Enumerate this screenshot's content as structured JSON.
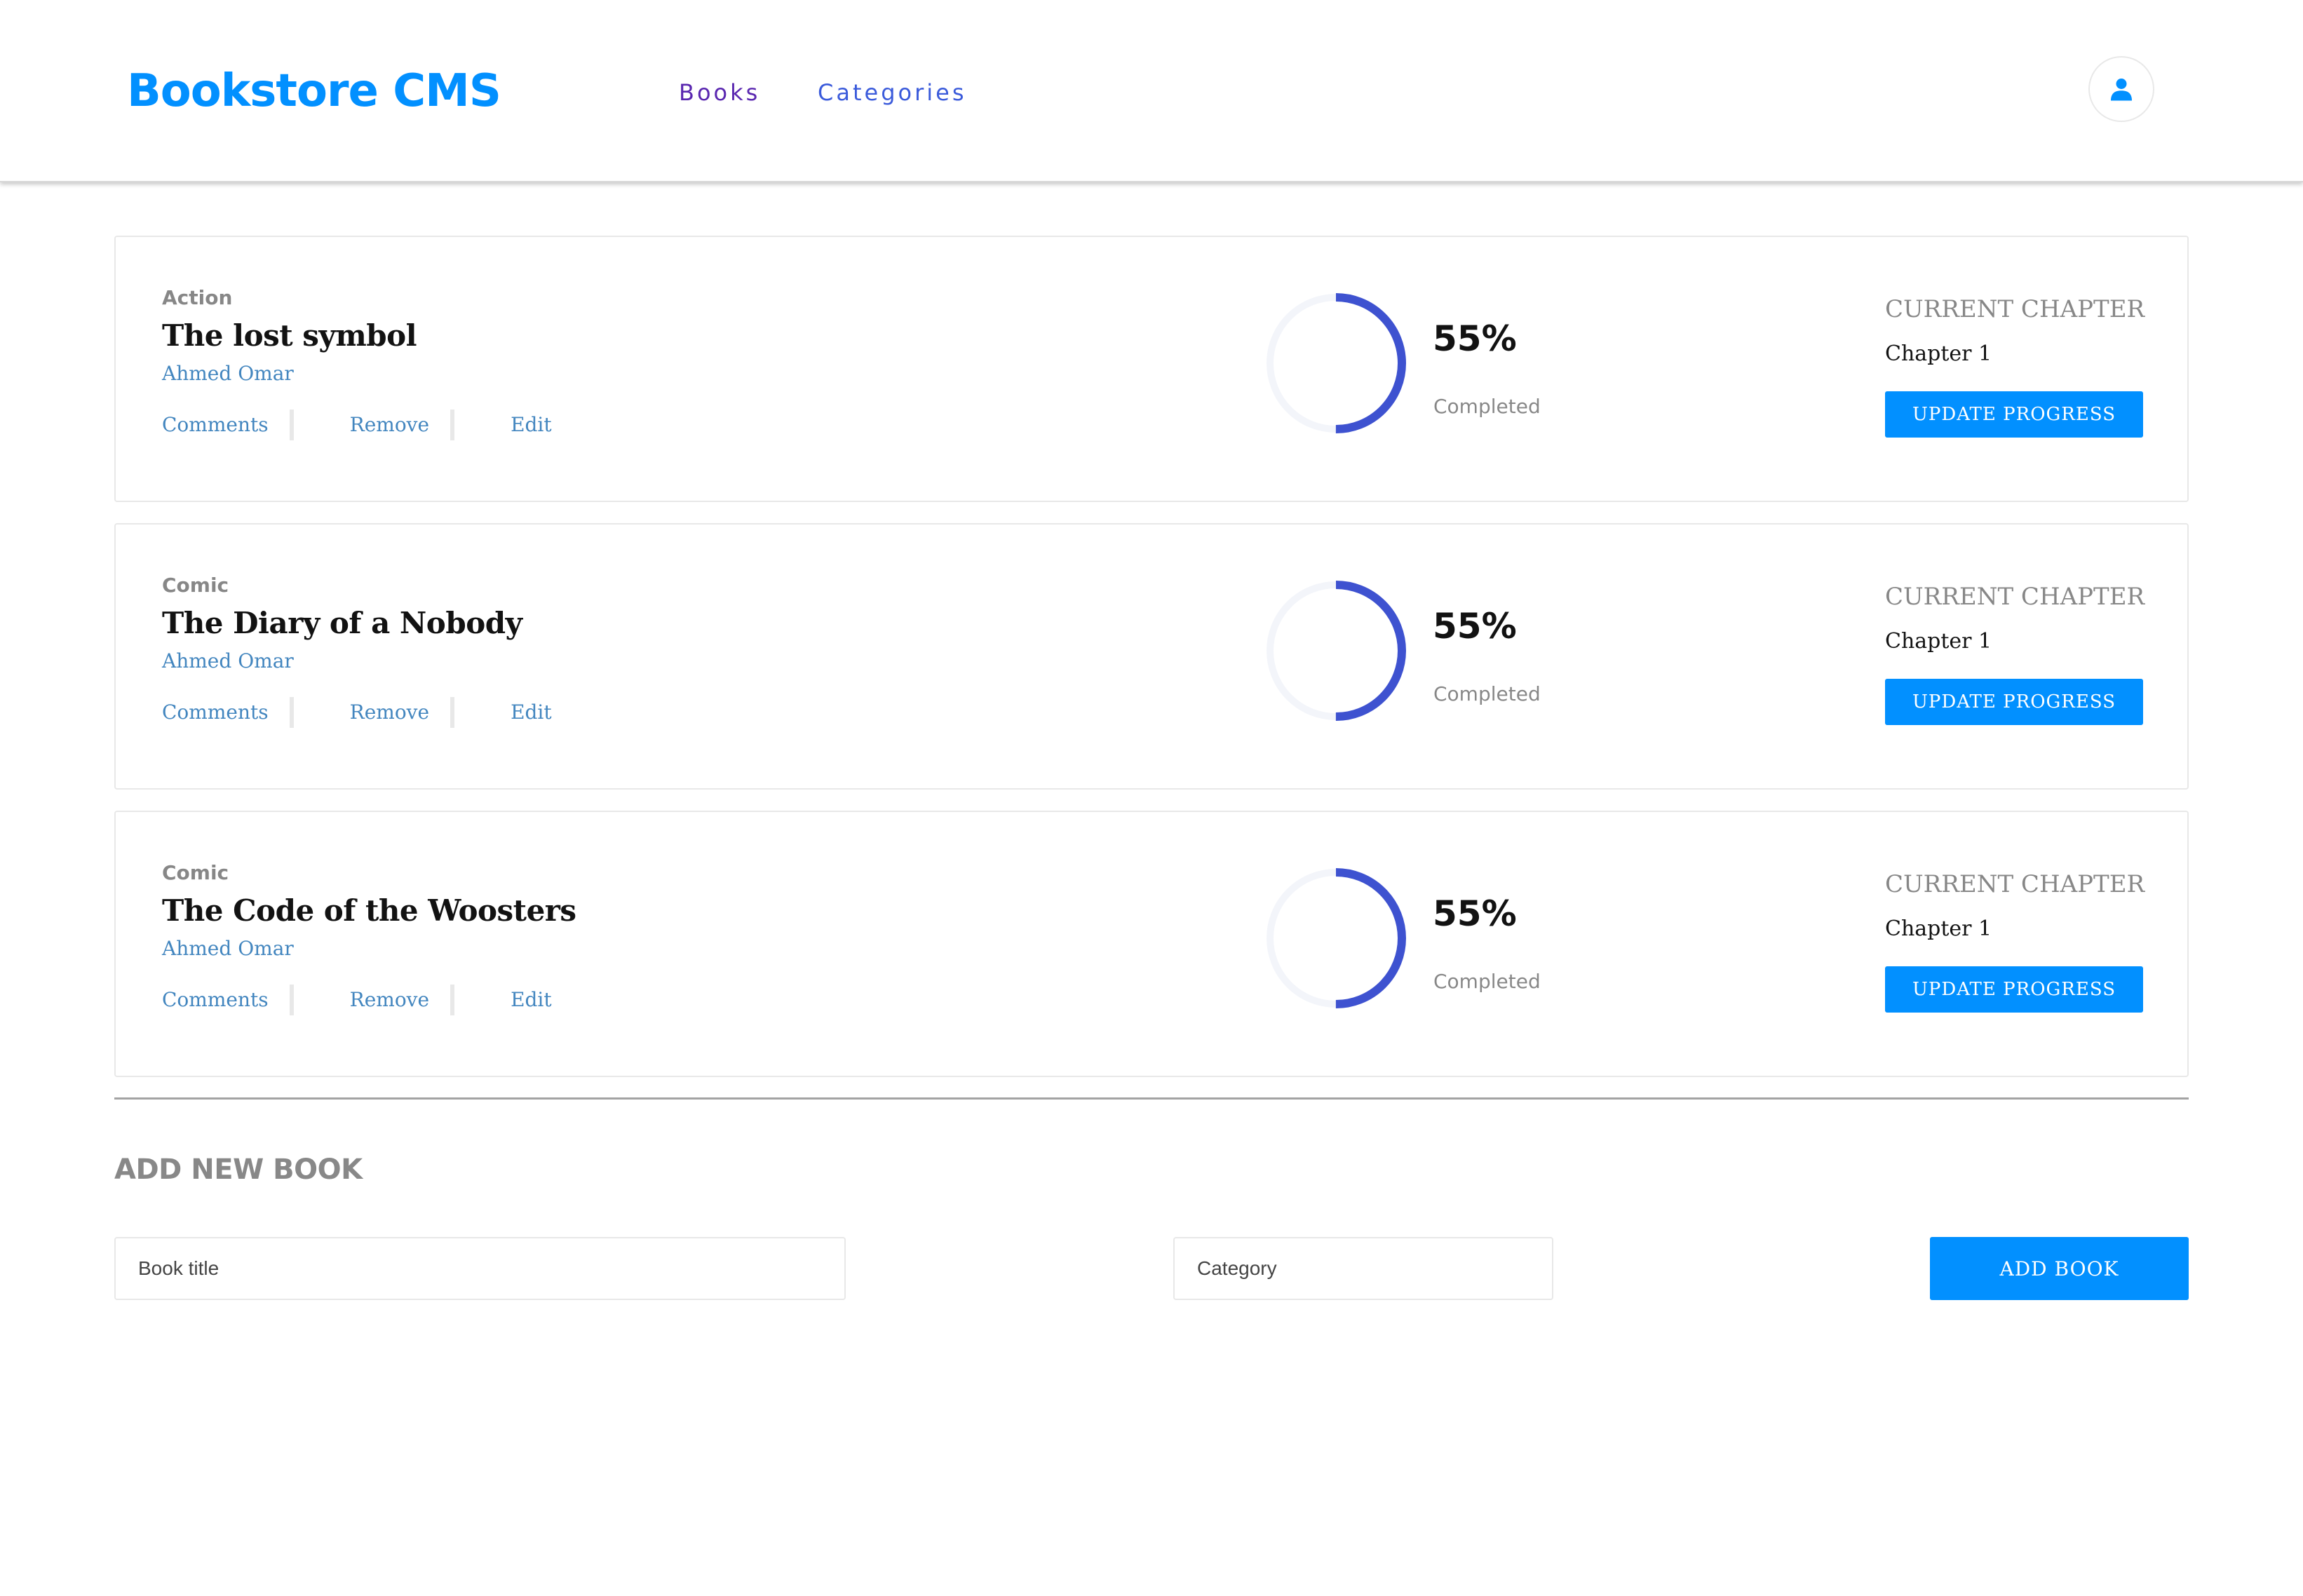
{
  "header": {
    "brand": "Bookstore CMS",
    "nav": [
      {
        "label": "Books",
        "color": "#5a27b0"
      },
      {
        "label": "Categories",
        "color": "#3b5bdb"
      }
    ],
    "user_icon": "user-icon"
  },
  "colors": {
    "brand": "#0290ff",
    "link": "#4386bf",
    "progress": "#3e52d0",
    "progress_track": "#f3f5fa"
  },
  "books": [
    {
      "genre": "Action",
      "title": "The lost symbol",
      "author": "Ahmed Omar",
      "actions": [
        "Comments",
        "Remove",
        "Edit"
      ],
      "progress_percent": 55,
      "progress_label": "55%",
      "progress_arc_fraction": 0.5,
      "completed_label": "Completed",
      "chapter_label": "CURRENT CHAPTER",
      "chapter": "Chapter 1",
      "update_label": "UPDATE PROGRESS"
    },
    {
      "genre": "Comic",
      "title": "The Diary of a Nobody",
      "author": "Ahmed Omar",
      "actions": [
        "Comments",
        "Remove",
        "Edit"
      ],
      "progress_percent": 55,
      "progress_label": "55%",
      "progress_arc_fraction": 0.5,
      "completed_label": "Completed",
      "chapter_label": "CURRENT CHAPTER",
      "chapter": "Chapter 1",
      "update_label": "UPDATE PROGRESS"
    },
    {
      "genre": "Comic",
      "title": "The Code of the Woosters",
      "author": "Ahmed Omar",
      "actions": [
        "Comments",
        "Remove",
        "Edit"
      ],
      "progress_percent": 55,
      "progress_label": "55%",
      "progress_arc_fraction": 0.5,
      "completed_label": "Completed",
      "chapter_label": "CURRENT CHAPTER",
      "chapter": "Chapter 1",
      "update_label": "UPDATE PROGRESS"
    }
  ],
  "add_form": {
    "title": "ADD NEW BOOK",
    "book_title_placeholder": "Book title",
    "book_title_value": "",
    "category_placeholder": "Category",
    "category_value": "",
    "submit_label": "ADD BOOK"
  }
}
